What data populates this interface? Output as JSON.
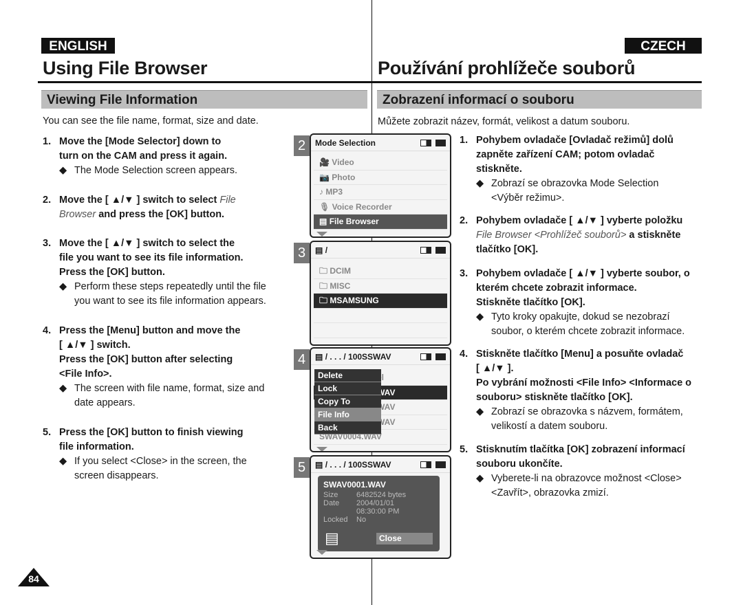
{
  "english": {
    "lang_label": "ENGLISH",
    "title": "Using File Browser",
    "section": "Viewing File Information",
    "intro": "You can see the file name, format, size and date.",
    "steps": [
      {
        "num": "1.",
        "lines": [
          "Move the [Mode Selector] down to",
          "turn on the CAM and press it again."
        ],
        "bullets": [
          [
            "The Mode Selection screen appears."
          ]
        ]
      },
      {
        "num": "2.",
        "line1": "Move the [ ▲/▼ ] switch to select ",
        "line1_italic": "File",
        "line2_italic": "Browser",
        "line2": " and press the [OK] button.",
        "bullets": []
      },
      {
        "num": "3.",
        "lines": [
          "Move the [ ▲/▼ ] switch to select the",
          "file you want to see its file information.",
          "Press the [OK] button."
        ],
        "bullets": [
          [
            "Perform these steps repeatedly until the file",
            "you want to see its file information appears."
          ]
        ]
      },
      {
        "num": "4.",
        "lines": [
          "Press the [Menu] button and move the",
          "[ ▲/▼ ] switch.",
          "Press the [OK] button after selecting",
          "<File Info>."
        ],
        "bullets": [
          [
            "The screen with file name, format, size and",
            "date appears."
          ]
        ]
      },
      {
        "num": "5.",
        "lines": [
          "Press the [OK] button to finish viewing",
          "file information."
        ],
        "bullets": [
          [
            "If you select <Close> in the screen, the",
            "screen disappears."
          ]
        ]
      }
    ]
  },
  "czech": {
    "lang_label": "CZECH",
    "title": "Používání prohlížeče souborů",
    "section": "Zobrazení informací o souboru",
    "intro": "Můžete zobrazit název, formát, velikost a datum souboru.",
    "steps": [
      {
        "num": "1.",
        "lines": [
          "Pohybem ovladače [Ovladač režimů] dolů",
          "zapněte zařízení CAM; potom ovladač",
          "stiskněte."
        ],
        "bullets": [
          [
            "Zobrazí se obrazovka Mode Selection",
            "<Výběr režimu>."
          ]
        ]
      },
      {
        "num": "2.",
        "line1": "Pohybem ovladače [ ▲/▼ ] vyberte položku",
        "line2_italic": "File Browser <Prohlížeč souborů>",
        "line2": " a stiskněte",
        "line3": "tlačítko [OK].",
        "bullets": []
      },
      {
        "num": "3.",
        "lines": [
          "Pohybem ovladače [ ▲/▼ ] vyberte soubor, o",
          "kterém chcete zobrazit informace.",
          "Stiskněte tlačítko [OK]."
        ],
        "bullets": [
          [
            "Tyto kroky opakujte, dokud se nezobrazí",
            "soubor, o kterém chcete zobrazit informace."
          ]
        ]
      },
      {
        "num": "4.",
        "lines": [
          "Stiskněte tlačítko [Menu] a posuňte ovladač",
          "[ ▲/▼ ].",
          "Po vybrání možnosti <File Info> <Informace o",
          "souboru> stiskněte tlačítko [OK]."
        ],
        "bullets": [
          [
            "Zobrazí se obrazovka s názvem, formátem,",
            "velikostí a datem souboru."
          ]
        ]
      },
      {
        "num": "5.",
        "lines": [
          "Stisknutím tlačítka [OK] zobrazení informací",
          "souboru ukončíte."
        ],
        "bullets": [
          [
            "Vyberete-li na obrazovce možnost <Close>",
            "<Zavřít>, obrazovka zmizí."
          ]
        ]
      }
    ]
  },
  "bullet_glyph": "◆",
  "screens": {
    "s2": {
      "num": "2",
      "title": "Mode Selection",
      "items": [
        "Video",
        "Photo",
        "MP3",
        "Voice Recorder",
        "File Browser"
      ],
      "icons": [
        "video-camera-icon",
        "camera-icon",
        "music-note-icon",
        "microphone-icon",
        "file-icon"
      ],
      "icon_glyphs": [
        "🎥",
        "📷",
        "♪",
        "🎙",
        "▤"
      ],
      "selected": "File Browser"
    },
    "s3": {
      "num": "3",
      "path": "/",
      "items": [
        "DCIM",
        "MISC",
        "MSAMSUNG"
      ],
      "selected": "MSAMSUNG",
      "folder_glyph": "🗀"
    },
    "s4": {
      "num": "4",
      "path": "/ . . . / 100SSWAV",
      "behind": [
        "el",
        "WAV",
        "WAV",
        "WAV",
        "SWAV0004.WAV"
      ],
      "menu": [
        "Delete",
        "Lock",
        "Copy To",
        "File Info",
        "Back"
      ],
      "active": "File Info"
    },
    "s5": {
      "num": "5",
      "path": "/ . . . / 100SSWAV",
      "filename": "SWAV0001.WAV",
      "size_label": "Size",
      "size": "6482524 bytes",
      "date_label": "Date",
      "date": "2004/01/01",
      "time": "08:30:00 PM",
      "locked_label": "Locked",
      "locked": "No",
      "close": "Close"
    }
  },
  "page_number": "84"
}
